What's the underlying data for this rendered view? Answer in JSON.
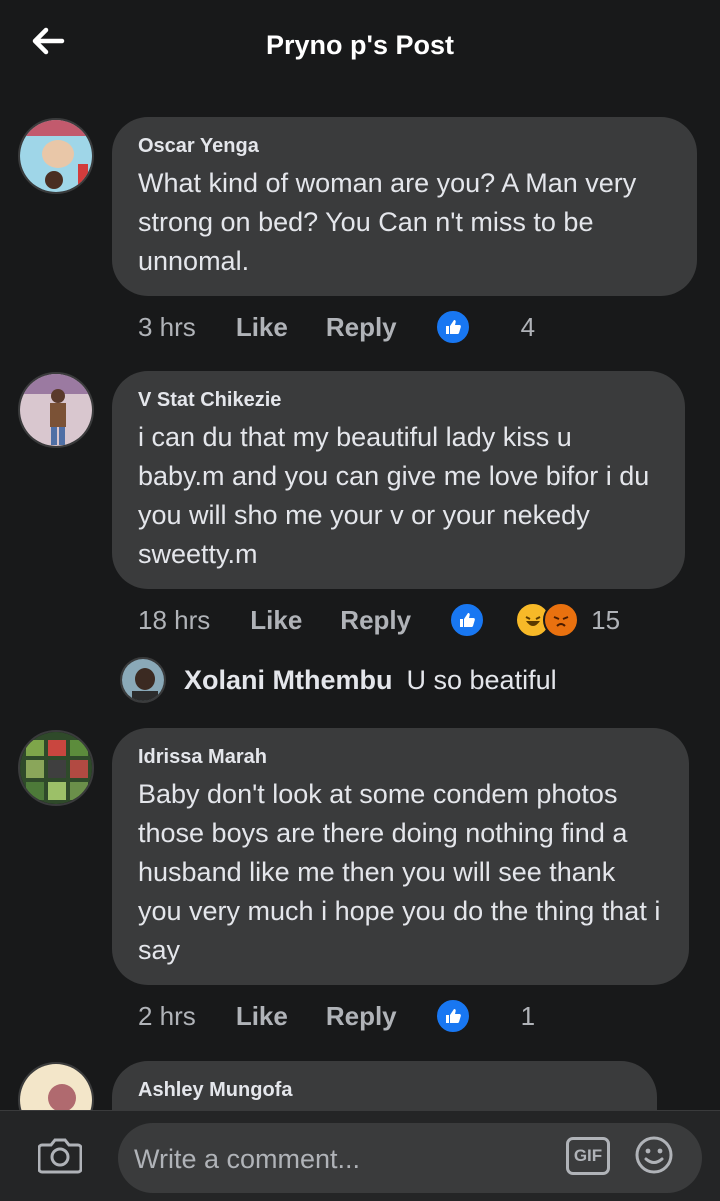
{
  "header": {
    "title": "Pryno p's Post"
  },
  "comments": [
    {
      "name": "Oscar Yenga",
      "text": "What kind of woman are you? A Man very strong  on bed? You Can n't  miss to be unnomal.",
      "time": "3 hrs",
      "like_label": "Like",
      "reply_label": "Reply",
      "reactions": [
        "like"
      ],
      "count": "4"
    },
    {
      "name": "V Stat Chikezie",
      "text": "i can du that my beautiful lady kiss u baby.m and you can give me love bifor i du you will sho me your v or your nekedy sweetty.m",
      "time": "18 hrs",
      "like_label": "Like",
      "reply_label": "Reply",
      "reactions": [
        "like",
        "haha",
        "angry"
      ],
      "count": "15"
    },
    {
      "name": "Idrissa Marah",
      "text": "Baby don't look at some condem photos those boys are there doing nothing find a husband like me then you will see thank you very much i hope you do the thing that i say",
      "time": "2 hrs",
      "like_label": "Like",
      "reply_label": "Reply",
      "reactions": [
        "like"
      ],
      "count": "1"
    },
    {
      "name": "Ashley Mungofa"
    }
  ],
  "reply_preview": {
    "name": "Xolani Mthembu",
    "text": "U so beatiful"
  },
  "composer": {
    "placeholder": "Write a comment...",
    "gif_label": "GIF"
  },
  "icons": {
    "back": "arrow-left-icon",
    "camera": "camera-icon",
    "emoji": "smiley-icon",
    "like": "thumbs-up-icon",
    "haha": "laughing-face-icon",
    "angry": "angry-face-icon"
  },
  "colors": {
    "background": "#18191a",
    "bubble": "#3a3b3c",
    "accent": "#1877f2",
    "haha": "#f7b928",
    "angry": "#e9710f"
  }
}
